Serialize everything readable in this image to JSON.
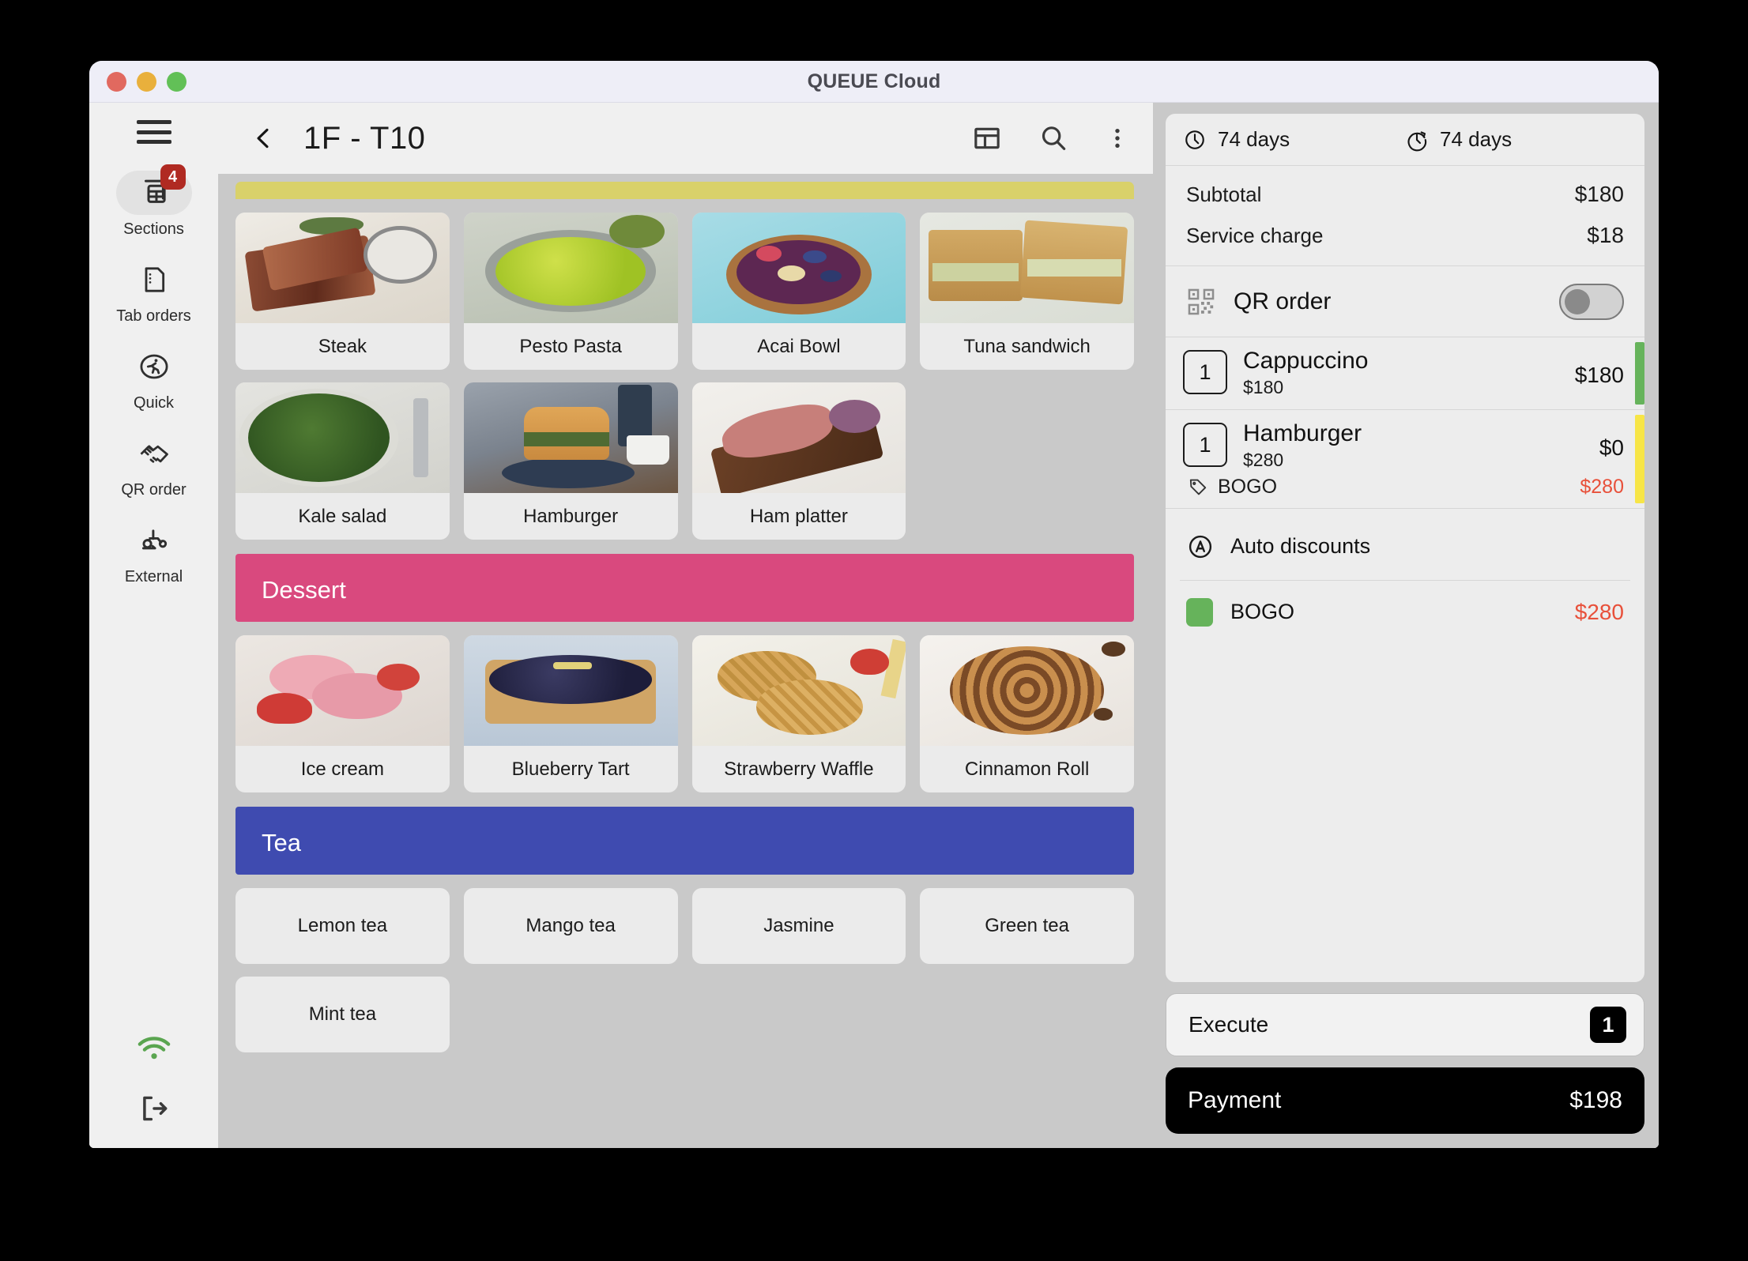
{
  "window": {
    "title": "QUEUE Cloud",
    "traffic_lights": [
      "close",
      "minimize",
      "maximize"
    ]
  },
  "header": {
    "back_icon": "chevron-left-icon",
    "title": "1F - T10",
    "actions": [
      {
        "name": "layout-icon",
        "label": "Layout"
      },
      {
        "name": "search-icon",
        "label": "Search"
      },
      {
        "name": "more-vertical-icon",
        "label": "More"
      }
    ]
  },
  "sidebar": {
    "menu_icon": "hamburger-menu-icon",
    "items": [
      {
        "label": "Sections",
        "icon": "table-grid-icon",
        "badge": "4",
        "active": true
      },
      {
        "label": "Tab orders",
        "icon": "document-icon",
        "badge": "",
        "active": false
      },
      {
        "label": "Quick",
        "icon": "runner-icon",
        "badge": "",
        "active": false
      },
      {
        "label": "QR order",
        "icon": "handshake-icon",
        "badge": "",
        "active": false
      },
      {
        "label": "External",
        "icon": "scooter-icon",
        "badge": "",
        "active": false
      }
    ],
    "bottom": [
      {
        "name": "wifi-icon",
        "color": "#5aa550"
      },
      {
        "name": "logout-icon",
        "color": "#3a3a3a"
      }
    ]
  },
  "menu": {
    "sections": [
      {
        "title": "",
        "color": "#d9d16a",
        "partial": true,
        "style": "image",
        "items": [
          {
            "label": "Steak",
            "thumb": "t-steak"
          },
          {
            "label": "Pesto Pasta",
            "thumb": "t-pesto"
          },
          {
            "label": "Acai Bowl",
            "thumb": "t-acai"
          },
          {
            "label": "Tuna sandwich",
            "thumb": "t-tuna"
          },
          {
            "label": "Kale salad",
            "thumb": "t-kale"
          },
          {
            "label": "Hamburger",
            "thumb": "t-burger"
          },
          {
            "label": "Ham platter",
            "thumb": "t-ham"
          }
        ]
      },
      {
        "title": "Dessert",
        "color": "#d9497e",
        "partial": false,
        "style": "image",
        "items": [
          {
            "label": "Ice cream",
            "thumb": "t-ice"
          },
          {
            "label": "Blueberry Tart",
            "thumb": "t-tart"
          },
          {
            "label": "Strawberry Waffle",
            "thumb": "t-waffle"
          },
          {
            "label": "Cinnamon Roll",
            "thumb": "t-roll"
          }
        ]
      },
      {
        "title": "Tea",
        "color": "#3f4bb0",
        "partial": false,
        "style": "plain",
        "items": [
          {
            "label": "Lemon tea",
            "thumb": ""
          },
          {
            "label": "Mango tea",
            "thumb": ""
          },
          {
            "label": "Jasmine",
            "thumb": ""
          },
          {
            "label": "Green tea",
            "thumb": ""
          },
          {
            "label": "Mint tea",
            "thumb": ""
          }
        ]
      }
    ]
  },
  "order": {
    "timers": [
      {
        "icon": "clock-icon",
        "value": "74 days"
      },
      {
        "icon": "clock-restore-icon",
        "value": "74 days"
      }
    ],
    "totals": [
      {
        "label": "Subtotal",
        "amount": "$180"
      },
      {
        "label": "Service charge",
        "amount": "$18"
      }
    ],
    "qr_order": {
      "icon": "qr-code-icon",
      "label": "QR order",
      "toggle_on": false
    },
    "items": [
      {
        "qty": "1",
        "name": "Cappuccino",
        "unit_price": "$180",
        "amount": "$180",
        "status_color": "#66b35b",
        "discount": null
      },
      {
        "qty": "1",
        "name": "Hamburger",
        "unit_price": "$280",
        "amount": "$0",
        "status_color": "#f7e547",
        "discount": {
          "icon": "tag-icon",
          "label": "BOGO",
          "amount": "$280"
        }
      }
    ],
    "auto_discounts": {
      "icon": "circle-a-icon",
      "label": "Auto discounts",
      "entries": [
        {
          "swatch_color": "#66b35b",
          "label": "BOGO",
          "amount": "$280"
        }
      ]
    },
    "execute": {
      "label": "Execute",
      "count": "1"
    },
    "payment": {
      "label": "Payment",
      "amount": "$198"
    }
  },
  "colors": {
    "accent_red": "#e8503a",
    "badge_red": "#b02a22",
    "dessert": "#d9497e",
    "tea": "#3f4bb0",
    "partial_yellow": "#d9d16a",
    "green": "#66b35b"
  }
}
